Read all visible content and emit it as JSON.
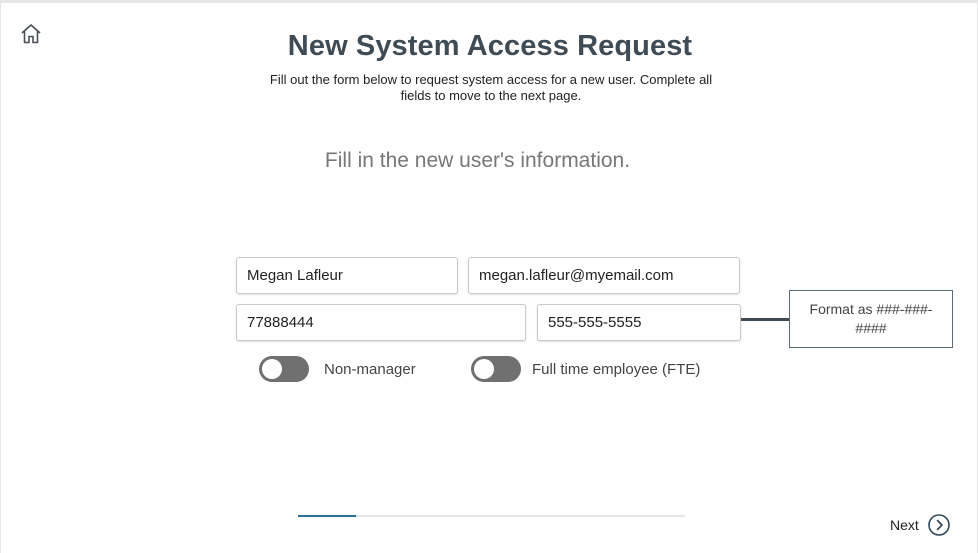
{
  "header": {
    "title": "New System Access Request",
    "subtitle": "Fill out the form below to request system access for a new user. Complete all fields to move to the next page."
  },
  "section": {
    "heading": "Fill in the new user's information."
  },
  "form": {
    "name": "Megan Lafleur",
    "email": "megan.lafleur@myemail.com",
    "employee_id": "77888444",
    "phone": "555-555-5555",
    "phone_hint": "Format as ###-###-####",
    "manager_toggle": {
      "label": "Non-manager",
      "on": false
    },
    "fte_toggle": {
      "label": "Full time employee (FTE)",
      "on": false
    }
  },
  "footer": {
    "progress_fraction": 0.15,
    "next_label": "Next"
  },
  "icons": {
    "home": "home-icon",
    "next": "chevron-right-circle-icon"
  },
  "colors": {
    "title": "#3f4b55",
    "toggle_off": "#707070",
    "progress": "#2e6f9e"
  }
}
